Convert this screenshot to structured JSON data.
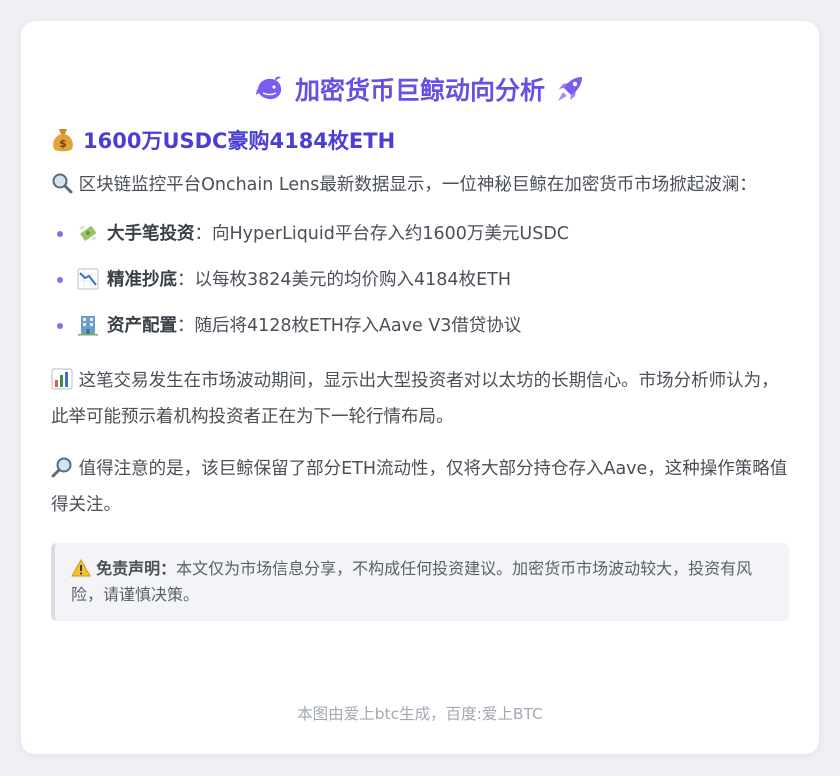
{
  "header": {
    "title": "加密货币巨鲸动向分析",
    "title_left_icon": "whale-icon",
    "title_right_icon": "rocket-icon"
  },
  "headline": {
    "icon": "money-bag-icon",
    "text": "1600万USDC豪购4184枚ETH"
  },
  "intro": {
    "icon": "magnifier-icon",
    "text": "区块链监控平台Onchain Lens最新数据显示，一位神秘巨鲸在加密货币市场掀起波澜："
  },
  "points": [
    {
      "icon": "money-wings-icon",
      "label": "大手笔投资",
      "text": "：向HyperLiquid平台存入约1600万美元USDC"
    },
    {
      "icon": "chart-down-icon",
      "label": "精准抄底",
      "text": "：以每枚3824美元的均价购入4184枚ETH"
    },
    {
      "icon": "bank-building-icon",
      "label": "资产配置",
      "text": "：随后将4128枚ETH存入Aave V3借贷协议"
    }
  ],
  "analysis": {
    "icon": "bar-chart-icon",
    "text": "这笔交易发生在市场波动期间，显示出大型投资者对以太坊的长期信心。市场分析师认为，此举可能预示着机构投资者正在为下一轮行情布局。"
  },
  "note": {
    "icon": "magnifier-right-icon",
    "text": "值得注意的是，该巨鲸保留了部分ETH流动性，仅将大部分持仓存入Aave，这种操作策略值得关注。"
  },
  "disclaimer": {
    "icon": "warning-icon",
    "label": "免责声明：",
    "text": "本文仅为市场信息分享，不构成任何投资建议。加密货币市场波动较大，投资有风险，请谨慎决策。"
  },
  "footer": {
    "text": "本图由爱上btc生成，百度:爱上BTC"
  },
  "colors": {
    "accent": "#6a4fe4",
    "headline": "#4a3fd4",
    "bullet": "#8a6de6",
    "background": "#eef0f5"
  }
}
